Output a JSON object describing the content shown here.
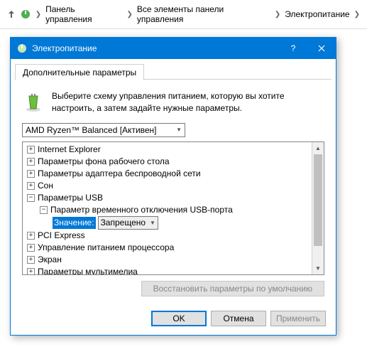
{
  "breadcrumb": {
    "items": [
      "Панель управления",
      "Все элементы панели управления",
      "Электропитание"
    ]
  },
  "window": {
    "title": "Электропитание",
    "tab": "Дополнительные параметры",
    "info": "Выберите схему управления питанием, которую вы хотите настроить, а затем задайте нужные параметры.",
    "plan": "AMD Ryzen™ Balanced [Активен]",
    "tree": {
      "ie": "Internet Explorer",
      "desktop_bg": "Параметры фона рабочего стола",
      "wifi": "Параметры адаптера беспроводной сети",
      "sleep": "Сон",
      "usb": "Параметры USB",
      "usb_suspend": "Параметр временного отключения USB-порта",
      "value_label": "Значение:",
      "value": "Запрещено",
      "pci": "PCI Express",
      "cpu": "Управление питанием процессора",
      "screen": "Экран",
      "multimedia": "Параметры мультимелиа"
    },
    "restore": "Восстановить параметры по умолчанию",
    "ok": "OK",
    "cancel": "Отмена",
    "apply": "Применить"
  }
}
